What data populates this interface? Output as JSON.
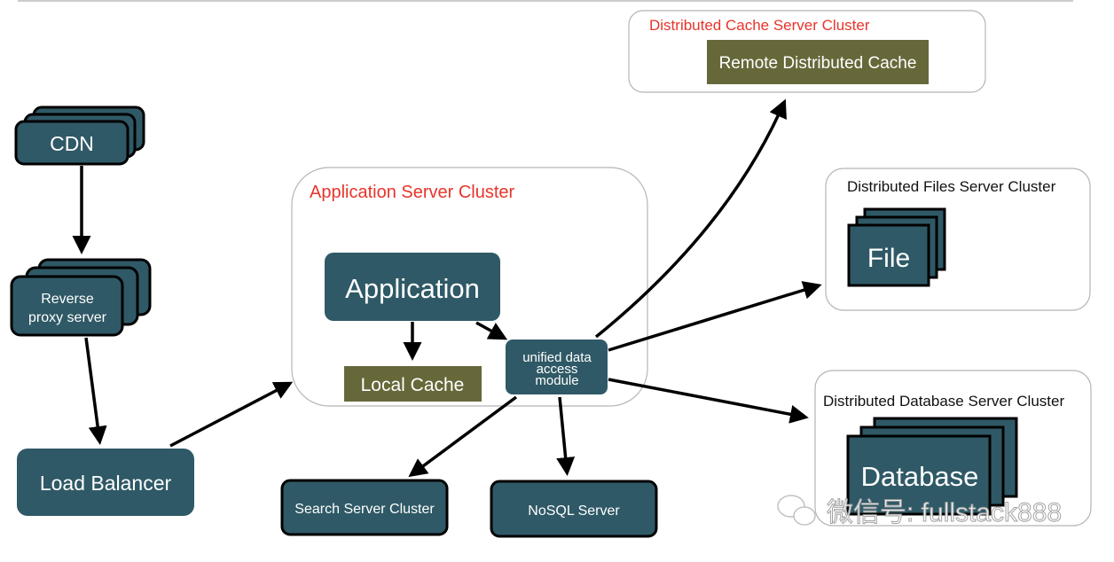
{
  "colors": {
    "node": "#2f5966",
    "cache": "#66683a",
    "cluster_title_accent": "#e8342b",
    "arrow": "#000000"
  },
  "nodes": {
    "cdn": "CDN",
    "reverse_proxy": [
      "Reverse",
      "proxy server"
    ],
    "load_balancer": "Load Balancer",
    "application": "Application",
    "local_cache": "Local Cache",
    "unified": [
      "unified data",
      "access",
      "module"
    ],
    "search": "Search Server Cluster",
    "nosql": "NoSQL Server",
    "remote_cache": "Remote Distributed Cache",
    "file": "File",
    "database": "Database"
  },
  "clusters": {
    "app": "Application Server Cluster",
    "cache": "Distributed Cache Server Cluster",
    "files": "Distributed Files Server Cluster",
    "db": "Distributed Database Server Cluster"
  },
  "watermark": {
    "text": "微信号: fullstack888",
    "icon": "wechat-icon"
  }
}
